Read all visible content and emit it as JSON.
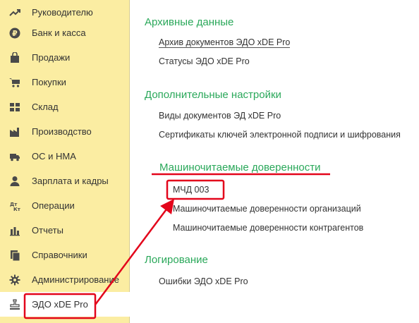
{
  "sidebar": {
    "items": [
      {
        "label": "Руководителю",
        "icon": "trend-icon"
      },
      {
        "label": "Банк и касса",
        "icon": "ruble-coin-icon"
      },
      {
        "label": "Продажи",
        "icon": "shopping-bag-icon"
      },
      {
        "label": "Покупки",
        "icon": "cart-icon"
      },
      {
        "label": "Склад",
        "icon": "warehouse-grid-icon"
      },
      {
        "label": "Производство",
        "icon": "factory-icon"
      },
      {
        "label": "ОС и НМА",
        "icon": "truck-icon"
      },
      {
        "label": "Зарплата и кадры",
        "icon": "person-icon"
      },
      {
        "label": "Операции",
        "icon": "debit-credit-icon"
      },
      {
        "label": "Отчеты",
        "icon": "bar-chart-icon"
      },
      {
        "label": "Справочники",
        "icon": "books-icon"
      },
      {
        "label": "Администрирование",
        "icon": "gear-icon"
      },
      {
        "label": "ЭДО xDE Pro",
        "icon": "stamp-icon",
        "active": true
      }
    ]
  },
  "main": {
    "sections": [
      {
        "title": "Архивные данные",
        "links": [
          "Архив документов ЭДО xDE Pro",
          "Статусы ЭДО xDE Pro"
        ]
      },
      {
        "title": "Дополнительные настройки",
        "links": [
          "Виды документов ЭД xDE Pro",
          "Сертификаты ключей электронной подписи и шифрования"
        ]
      },
      {
        "title": "Машиночитаемые доверенности",
        "links": [
          "МЧД 003",
          "Машиночитаемые доверенности организаций",
          "Машиночитаемые доверенности контрагентов"
        ]
      },
      {
        "title": "Логирование",
        "links": [
          "Ошибки ЭДО xDE Pro"
        ]
      }
    ]
  },
  "colors": {
    "sidebar_bg": "#fbeda2",
    "section_title": "#2aa85a",
    "annotation": "#e3051b"
  }
}
